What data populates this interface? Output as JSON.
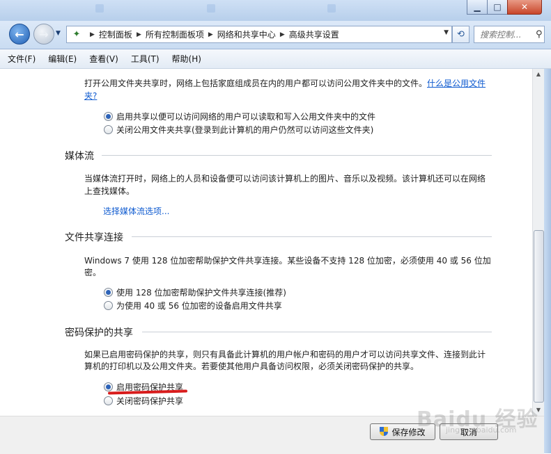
{
  "window": {
    "ghost_tabs": [
      "",
      "",
      ""
    ],
    "minimize_glyph": "▁",
    "maximize_glyph": "□",
    "close_glyph": "✕"
  },
  "nav": {
    "back_glyph": "←",
    "forward_glyph": "→",
    "breadcrumbs": [
      "控制面板",
      "所有控制面板项",
      "网络和共享中心",
      "高级共享设置"
    ],
    "search_placeholder": "搜索控制..."
  },
  "menu": [
    "文件(F)",
    "编辑(E)",
    "查看(V)",
    "工具(T)",
    "帮助(H)"
  ],
  "public_folder": {
    "description": "打开公用文件夹共享时，网络上包括家庭组成员在内的用户都可以访问公用文件夹中的文件。",
    "link": "什么是公用文件夹?",
    "link_line1": "什么是公用文件",
    "link_line2": "夹?",
    "options": [
      {
        "label": "启用共享以便可以访问网络的用户可以读取和写入公用文件夹中的文件",
        "selected": true
      },
      {
        "label": "关闭公用文件夹共享(登录到此计算机的用户仍然可以访问这些文件夹)",
        "selected": false
      }
    ]
  },
  "media": {
    "title": "媒体流",
    "description_line1": "当媒体流打开时，网络上的人员和设备便可以访问该计算机上的图片、音乐以及视频。该计算机还可以在网络",
    "description_line2": "上查找媒体。",
    "link": "选择媒体流选项..."
  },
  "file_sharing": {
    "title": "文件共享连接",
    "description_line1": "Windows 7 使用 128 位加密帮助保护文件共享连接。某些设备不支持 128 位加密，必须使用 40 或 56 位加",
    "description_line2": "密。",
    "options": [
      {
        "label": "使用 128 位加密帮助保护文件共享连接(推荐)",
        "selected": true
      },
      {
        "label": "为使用 40 或 56 位加密的设备启用文件共享",
        "selected": false
      }
    ]
  },
  "password": {
    "title": "密码保护的共享",
    "description_line1": "如果已启用密码保护的共享，则只有具备此计算机的用户帐户和密码的用户才可以访问共享文件、连接到此计",
    "description_line2": "算机的打印机以及公用文件夹。若要使其他用户具备访问权限，必须关闭密码保护的共享。",
    "options": [
      {
        "label": "启用密码保护共享",
        "selected": true
      },
      {
        "label": "关闭密码保护共享",
        "selected": false
      }
    ]
  },
  "buttons": {
    "save": "保存修改",
    "cancel": "取消"
  },
  "watermark": {
    "main": "Baidu 经验",
    "sub": "jingyan.baidu.com"
  },
  "colors": {
    "link": "#0f5bd0",
    "annotation": "#d81c1c"
  }
}
